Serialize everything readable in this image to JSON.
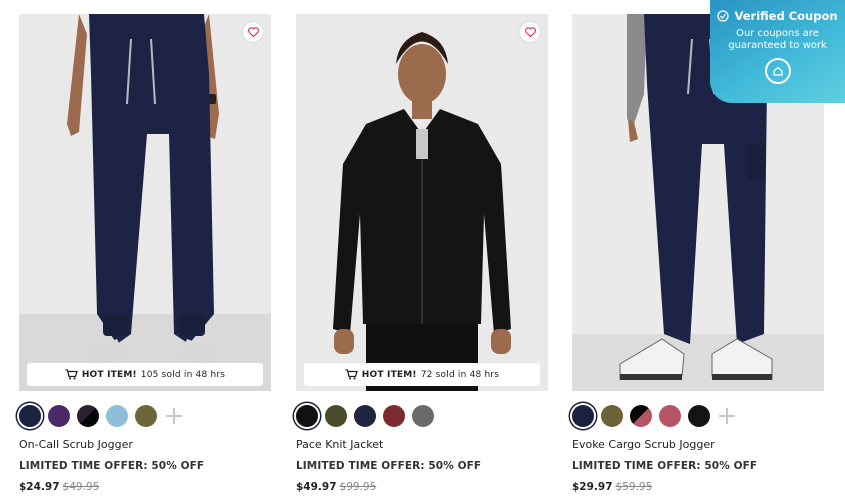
{
  "colors": {
    "accent": "#1b1f3b",
    "coupon_bg": "#40b8d8"
  },
  "products": [
    {
      "hot_label": "HOT ITEM!",
      "sold_text": "105 sold in 48 hrs",
      "swatches": [
        "#1b2240",
        "#4b2a6a",
        "navy-black-split",
        "#8fbfd8",
        "#6e6638"
      ],
      "name": "On-Call Scrub Jogger",
      "offer": "LIMITED TIME OFFER: 50% OFF",
      "price": "$24.97",
      "original_price": "$49.95"
    },
    {
      "hot_label": "HOT ITEM!",
      "sold_text": "72 sold in 48 hrs",
      "swatches": [
        "#111111",
        "#4a4a2c",
        "#1f2542",
        "#7b2a2e",
        "#6a6a6a"
      ],
      "name": "Pace Knit Jacket",
      "offer": "LIMITED TIME OFFER: 50% OFF",
      "price": "$49.97",
      "original_price": "$99.95"
    },
    {
      "swatches": [
        "#1b2240",
        "#6b6238",
        "black-rose-split",
        "#b35563",
        "#141414"
      ],
      "name": "Evoke Cargo Scrub Jogger",
      "offer": "LIMITED TIME OFFER: 50% OFF",
      "price": "$29.97",
      "original_price": "$59.95"
    }
  ],
  "coupon": {
    "title": "Verified Coupon",
    "subtitle": "Our coupons are guaranteed to work",
    "icon": "check-circle-icon"
  },
  "icons": {
    "favorite": "heart-icon",
    "cart": "cart-icon",
    "more_colors": "plus-icon"
  }
}
